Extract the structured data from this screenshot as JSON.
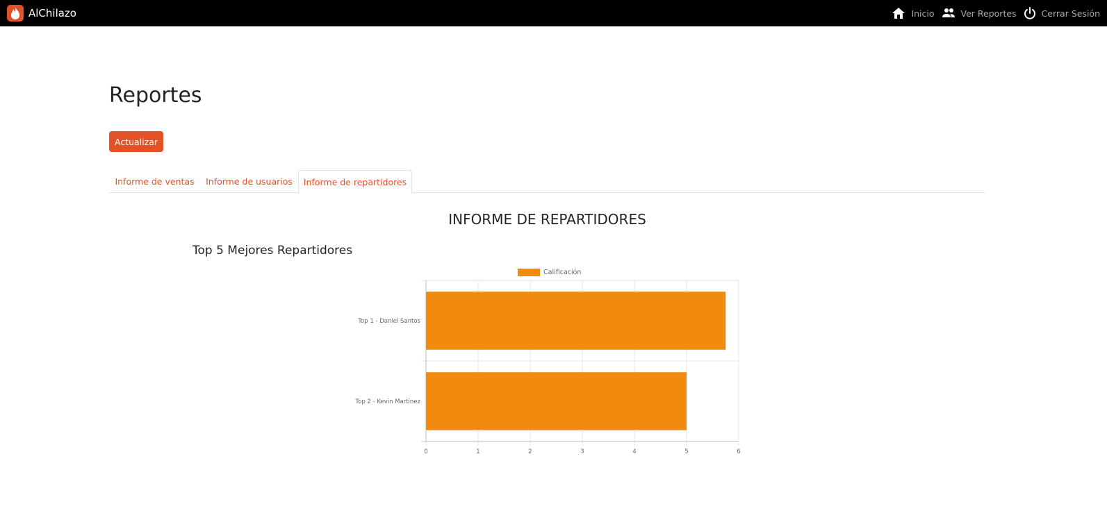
{
  "navbar": {
    "brand": "AlChilazo",
    "links": [
      {
        "label": "Inicio",
        "icon": "home-icon"
      },
      {
        "label": "Ver Reportes",
        "icon": "people-icon"
      },
      {
        "label": "Cerrar Sesión",
        "icon": "power-icon"
      }
    ]
  },
  "page": {
    "title": "Reportes",
    "refresh_label": "Actualizar"
  },
  "tabs": [
    {
      "label": "Informe de ventas",
      "active": false
    },
    {
      "label": "Informe de usuarios",
      "active": false
    },
    {
      "label": "Informe de repartidores",
      "active": true
    }
  ],
  "report": {
    "section_title": "INFORME DE REPARTIDORES",
    "chart_title": "Top 5 Mejores Repartidores"
  },
  "colors": {
    "accent": "#e25226",
    "bar": "#f28a10",
    "navbar": "#000000"
  },
  "chart_data": {
    "type": "bar",
    "orientation": "horizontal",
    "categories": [
      "Top 1 - Daniel Santos",
      "Top 2 - Kevin Martinez"
    ],
    "series": [
      {
        "name": "Calificación",
        "values": [
          5.75,
          5
        ]
      }
    ],
    "xlim": [
      0,
      6
    ],
    "xticks": [
      0,
      1,
      2,
      3,
      4,
      5,
      6
    ],
    "grid": true,
    "legend": "top"
  }
}
